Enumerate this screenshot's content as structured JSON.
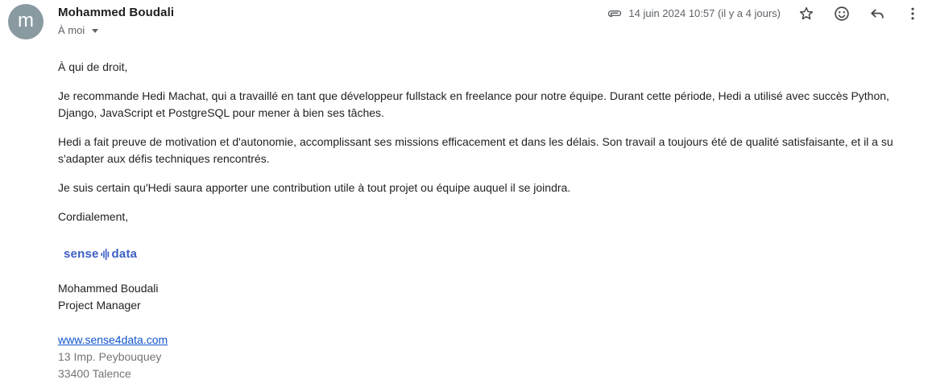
{
  "sender": {
    "avatar_letter": "m",
    "name": "Mohammed Boudali",
    "recipient_label": "À moi"
  },
  "meta": {
    "date": "14 juin 2024 10:57 (il y a 4 jours)",
    "has_attachment": true
  },
  "actions": {
    "star_icon": "star-icon",
    "emoji_icon": "emoji-icon",
    "reply_icon": "reply-icon",
    "more_icon": "more-vert-icon"
  },
  "body": {
    "greeting": "À qui de droit,",
    "paragraph1": "Je recommande Hedi Machat, qui a travaillé en tant que développeur fullstack en freelance pour notre équipe. Durant cette période, Hedi a utilisé avec succès Python, Django, JavaScript et PostgreSQL pour mener à bien ses tâches.",
    "paragraph2": "Hedi a fait preuve de motivation et d'autonomie, accomplissant ses missions efficacement et dans les délais. Son travail a toujours été de qualité satisfaisante, et il a su s'adapter aux défis techniques rencontrés.",
    "paragraph3": "Je suis certain qu'Hedi saura apporter une contribution utile à tout projet ou équipe auquel il se joindra.",
    "closing": "Cordialement,"
  },
  "signature": {
    "logo_left": "sense",
    "logo_right": "data",
    "logo_color": "#3d5fc4",
    "name": "Mohammed Boudali",
    "title": "Project Manager",
    "website": "www.sense4data.com",
    "address_line1": "13 Imp. Peybouquey",
    "address_line2": "33400 Talence"
  },
  "colors": {
    "avatar_bg": "#8a9aa1",
    "link": "#1155cc",
    "muted": "#5f6368"
  }
}
